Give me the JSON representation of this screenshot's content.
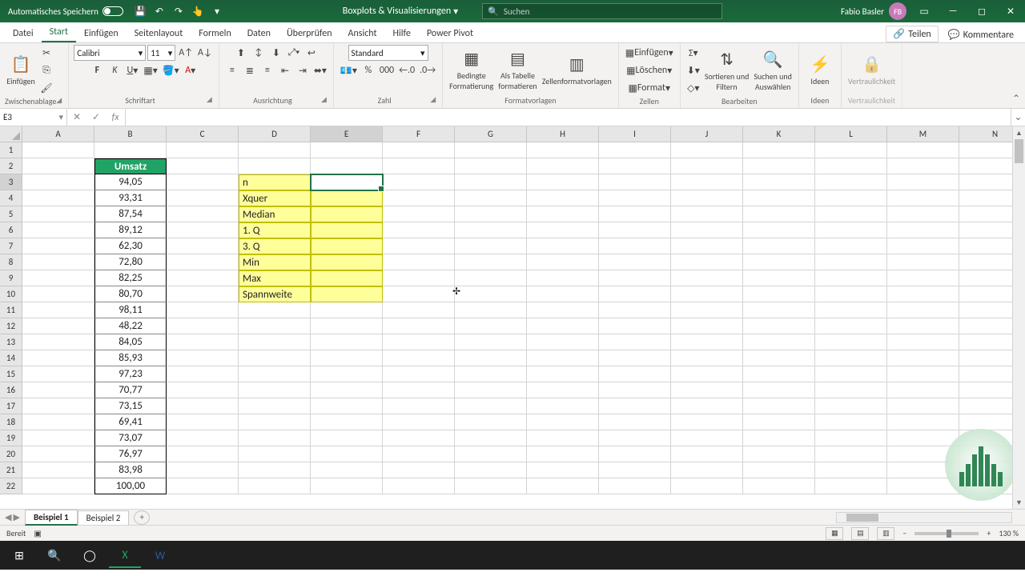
{
  "titlebar": {
    "autosave_label": "Automatisches Speichern",
    "doc_title": "Boxplots & Visualisierungen",
    "search_placeholder": "Suchen",
    "user_name": "Fabio Basler",
    "user_initials": "FB"
  },
  "tabs": {
    "t0": "Datei",
    "t1": "Start",
    "t2": "Einfügen",
    "t3": "Seitenlayout",
    "t4": "Formeln",
    "t5": "Daten",
    "t6": "Überprüfen",
    "t7": "Ansicht",
    "t8": "Hilfe",
    "t9": "Power Pivot",
    "share": "Teilen",
    "comments": "Kommentare"
  },
  "ribbon": {
    "clipboard": {
      "paste": "Einfügen",
      "label": "Zwischenablage"
    },
    "font": {
      "name": "Calibri",
      "size": "11",
      "label": "Schriftart"
    },
    "align": {
      "label": "Ausrichtung"
    },
    "number": {
      "standard": "Standard",
      "label": "Zahl"
    },
    "styles": {
      "cond": "Bedingte\nFormatierung",
      "table": "Als Tabelle\nformatieren",
      "cellstyles": "Zellenformatvorlagen",
      "label": "Formatvorlagen"
    },
    "cells": {
      "insert": "Einfügen",
      "delete": "Löschen",
      "format": "Format",
      "label": "Zellen"
    },
    "editing": {
      "sort": "Sortieren und\nFiltern",
      "find": "Suchen und\nAuswählen",
      "label": "Bearbeiten"
    },
    "ideas": {
      "ideas": "Ideen",
      "label": "Ideen"
    },
    "sens": {
      "sens": "Vertraulichkeit",
      "label": "Vertraulichkeit"
    }
  },
  "namebox": "E3",
  "columns": [
    "A",
    "B",
    "C",
    "D",
    "E",
    "F",
    "G",
    "H",
    "I",
    "J",
    "K",
    "L",
    "M",
    "N"
  ],
  "rows_visible": 22,
  "data": {
    "b2": "Umsatz",
    "b3": "94,05",
    "b4": "93,31",
    "b5": "87,54",
    "b6": "89,12",
    "b7": "62,30",
    "b8": "72,80",
    "b9": "82,25",
    "b10": "80,70",
    "b11": "98,11",
    "b12": "48,22",
    "b13": "84,05",
    "b14": "85,93",
    "b15": "97,23",
    "b16": "70,77",
    "b17": "73,15",
    "b18": "69,41",
    "b19": "73,07",
    "b20": "76,97",
    "b21": "83,98",
    "b22": "100,00",
    "d3": "n",
    "d4": "Xquer",
    "d5": "Median",
    "d6": "1. Q",
    "d7": "3. Q",
    "d8": "Min",
    "d9": "Max",
    "d10": "Spannweite"
  },
  "sheets": {
    "s1": "Beispiel 1",
    "s2": "Beispiel 2"
  },
  "status": {
    "ready": "Bereit",
    "zoom": "130 %"
  }
}
